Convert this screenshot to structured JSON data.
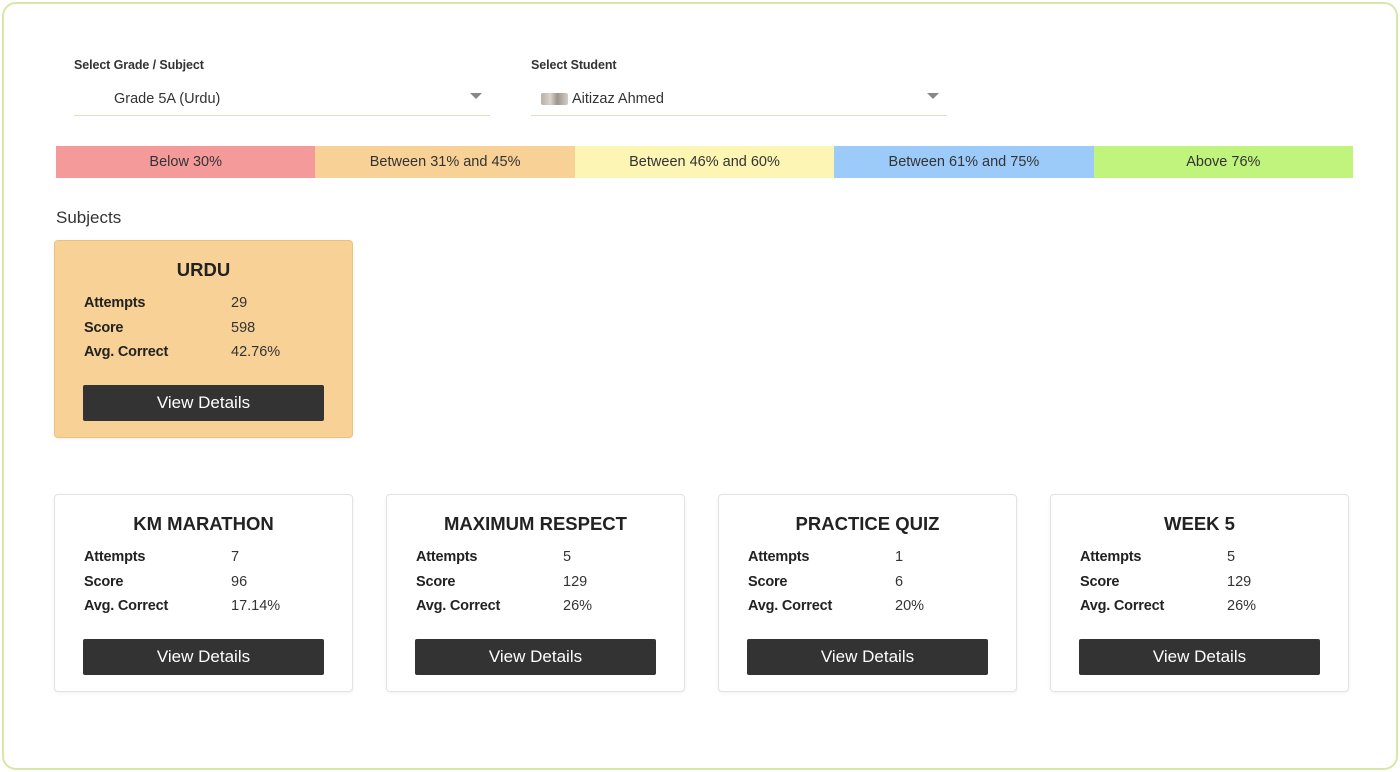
{
  "filters": {
    "grade": {
      "label": "Select Grade / Subject",
      "value": "Grade 5A (Urdu)"
    },
    "student": {
      "label": "Select Student",
      "value": "Aitizaz Ahmed"
    }
  },
  "legend": [
    {
      "label": "Below 30%",
      "color": "#f59a9a"
    },
    {
      "label": "Between 31% and 45%",
      "color": "#f7d196"
    },
    {
      "label": "Between 46% and 60%",
      "color": "#fdf5b3"
    },
    {
      "label": "Between 61% and 75%",
      "color": "#9ccbfa"
    },
    {
      "label": "Above 76%",
      "color": "#c0f47c"
    }
  ],
  "section_title": "Subjects",
  "stat_labels": {
    "attempts": "Attempts",
    "score": "Score",
    "avg": "Avg. Correct"
  },
  "button_label": "View Details",
  "subject_card": {
    "title": "URDU",
    "attempts": "29",
    "score": "598",
    "avg": "42.76%",
    "color": "#f7d196"
  },
  "activity_cards": [
    {
      "title": "KM MARATHON",
      "attempts": "7",
      "score": "96",
      "avg": "17.14%"
    },
    {
      "title": "MAXIMUM RESPECT",
      "attempts": "5",
      "score": "129",
      "avg": "26%"
    },
    {
      "title": "PRACTICE QUIZ",
      "attempts": "1",
      "score": "6",
      "avg": "20%"
    },
    {
      "title": "WEEK 5",
      "attempts": "5",
      "score": "129",
      "avg": "26%"
    }
  ]
}
